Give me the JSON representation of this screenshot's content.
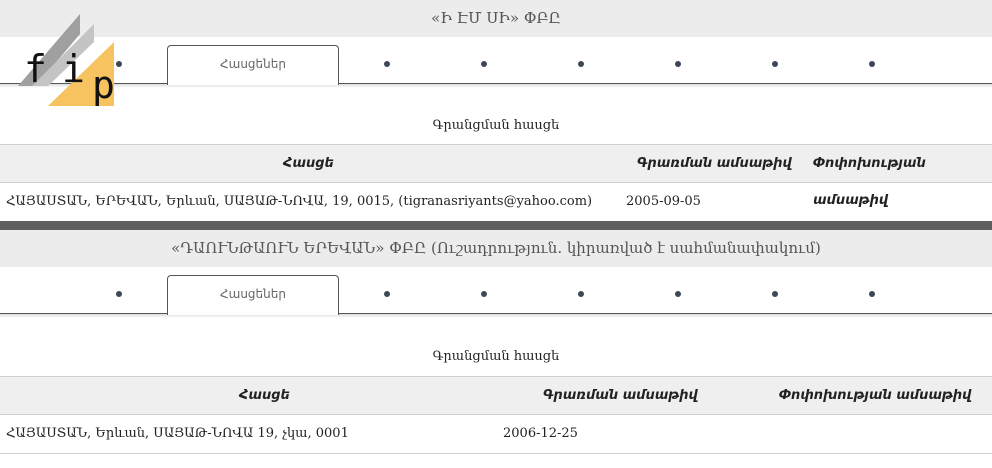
{
  "logo": {
    "text_f": "f",
    "text_i": "i",
    "text_p": "p",
    "icon": "fip-logo"
  },
  "companies": [
    {
      "title": "«Ի ԷՄ ՍԻ» ՓԲԸ",
      "tab_label": "Հասցեներ",
      "section_label": "Գրանցման հասցե",
      "headers": {
        "address": "Հասցե",
        "reg_date": "Գրառման ամսաթիվ",
        "change_date": "Փոփոխության ամսաթիվ"
      },
      "rows": [
        {
          "address": "ՀԱՅԱՍՏԱՆ, ԵՐԵՎԱՆ, Երևան, ՍԱՅԱԹ-ՆՈՎԱ, 19, 0015, (tigranasriyants@yahoo.com)",
          "reg_date": "2005-09-05",
          "change_date": ""
        }
      ]
    },
    {
      "title": "«ԴԱՈՒՆԹԱՈՒՆ ԵՐԵՎԱՆ» ՓԲԸ (Ուշադրություն. կիրառված է սահմանափակում)",
      "tab_label": "Հասցեներ",
      "section_label": "Գրանցման հասցե",
      "headers": {
        "address": "Հասցե",
        "reg_date": "Գրառման ամսաթիվ",
        "change_date": "Փոփոխության ամսաթիվ"
      },
      "rows": [
        {
          "address": "ՀԱՅԱՍՏԱՆ, Երևան, ՍԱՅԱԹ-ՆՈՎԱ 19, չկա, 0001",
          "reg_date": "2006-12-25",
          "change_date": ""
        }
      ]
    }
  ],
  "colors": {
    "header_bg": "#ececec",
    "divider": "#5e5e5e",
    "dot": "#3d4756",
    "logo_yellow": "#f7c260",
    "logo_gray": "#9a9a9a"
  }
}
